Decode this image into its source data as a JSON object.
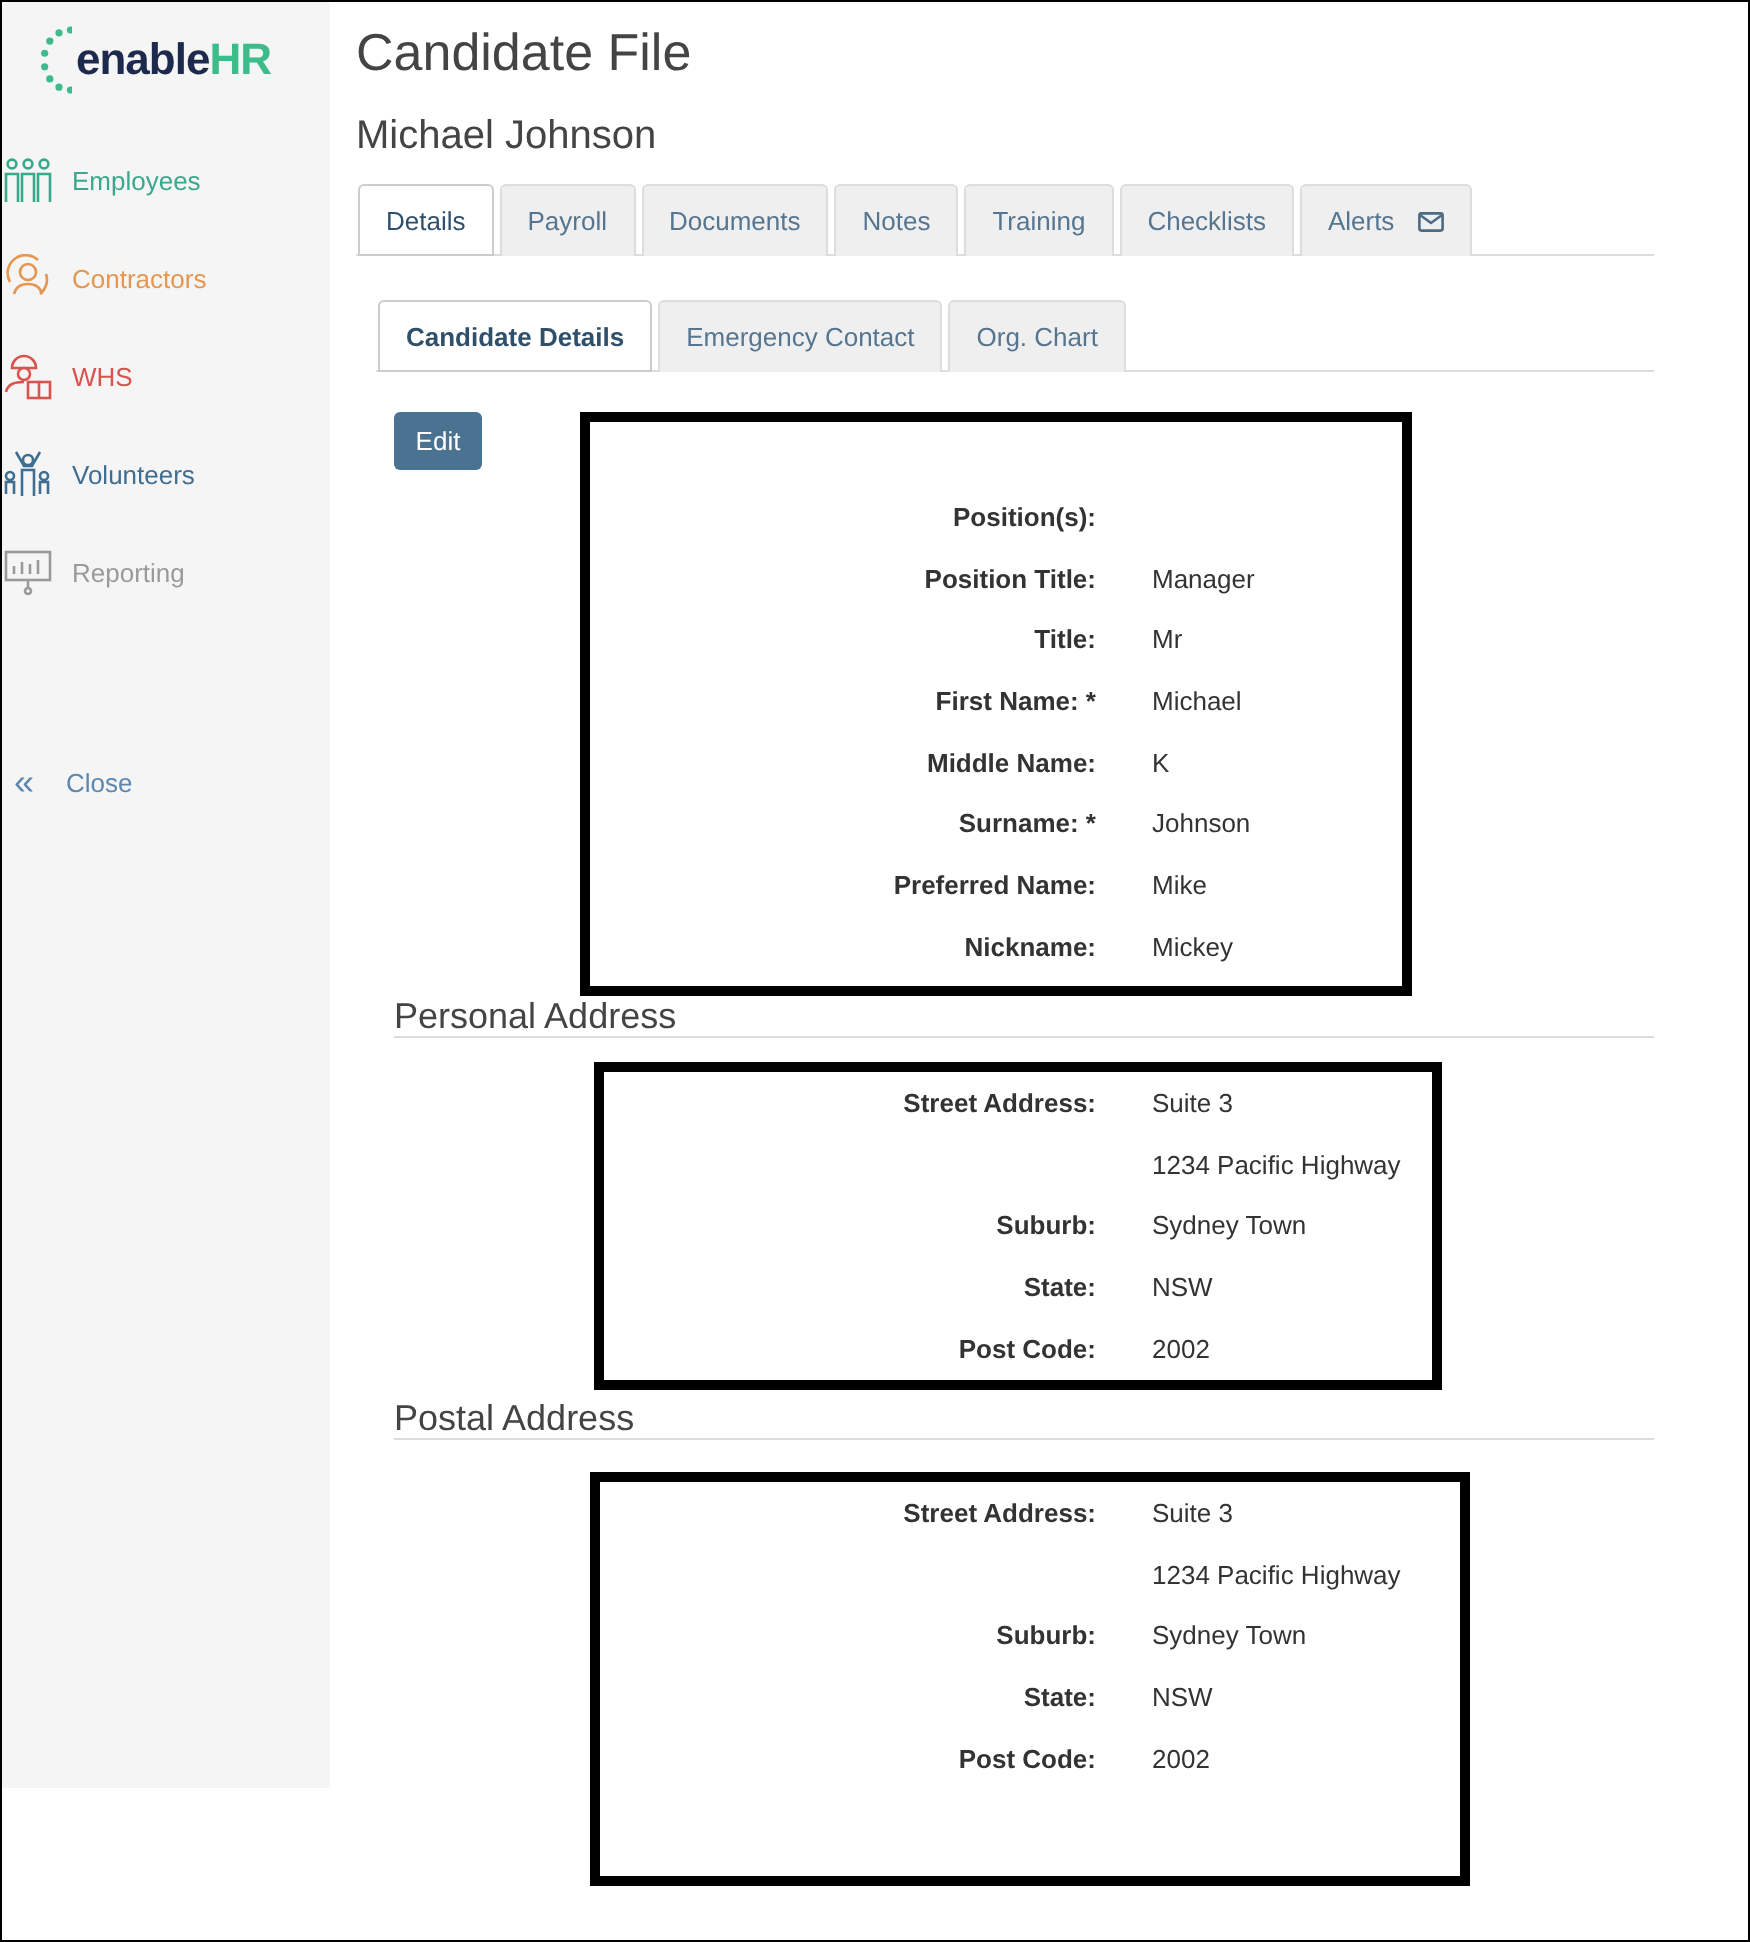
{
  "logo": {
    "primary": "enable",
    "accent": "HR"
  },
  "sidebar": {
    "items": [
      {
        "label": "Employees",
        "kind": "employees",
        "color": "#3aa88a"
      },
      {
        "label": "Contractors",
        "kind": "contractors",
        "color": "#e59650"
      },
      {
        "label": "WHS",
        "kind": "whs",
        "color": "#d9534f"
      },
      {
        "label": "Volunteers",
        "kind": "volunteers",
        "color": "#3f6e93"
      },
      {
        "label": "Reporting",
        "kind": "reporting",
        "color": "#9a9a9a"
      }
    ],
    "close": {
      "icon": "«",
      "label": "Close"
    }
  },
  "page": {
    "title": "Candidate File",
    "subtitle": "Michael Johnson"
  },
  "tabs": [
    {
      "label": "Details",
      "selected": true,
      "kind": "plain"
    },
    {
      "label": "Payroll",
      "selected": false,
      "kind": "plain"
    },
    {
      "label": "Documents",
      "selected": false,
      "kind": "plain"
    },
    {
      "label": "Notes",
      "selected": false,
      "kind": "plain"
    },
    {
      "label": "Training",
      "selected": false,
      "kind": "plain"
    },
    {
      "label": "Checklists",
      "selected": false,
      "kind": "plain"
    },
    {
      "label": "Alerts",
      "selected": false,
      "kind": "mail"
    }
  ],
  "subtabs": [
    {
      "label": "Candidate Details",
      "selected": true
    },
    {
      "label": "Emergency Contact",
      "selected": false
    },
    {
      "label": "Org. Chart",
      "selected": false
    }
  ],
  "edit_button": "Edit",
  "details": [
    {
      "label": "Position(s):"
    },
    {
      "label": "Position Title:",
      "value": "Manager"
    },
    {
      "label": "Title:",
      "value": "Mr"
    },
    {
      "label": "First Name: *",
      "value": "Michael"
    },
    {
      "label": "Middle Name:",
      "value": "K"
    },
    {
      "label": "Surname: *",
      "value": "Johnson"
    },
    {
      "label": "Preferred Name:",
      "value": "Mike"
    },
    {
      "label": "Nickname:",
      "value": "Mickey"
    }
  ],
  "sections": [
    {
      "title": "Personal Address",
      "fields": [
        {
          "label": "Street Address:",
          "value": "Suite 3"
        },
        {
          "value": "1234 Pacific Highway"
        },
        {
          "label": "Suburb:",
          "value": "Sydney Town"
        },
        {
          "label": "State:",
          "value": "NSW"
        },
        {
          "label": "Post Code:",
          "value": "2002"
        }
      ]
    },
    {
      "title": "Postal Address",
      "fields": [
        {
          "label": "Street Address:",
          "value": "Suite 3"
        },
        {
          "value": "1234 Pacific Highway"
        },
        {
          "label": "Suburb:",
          "value": "Sydney Town"
        },
        {
          "label": "State:",
          "value": "NSW"
        },
        {
          "label": "Post Code:",
          "value": "2002"
        }
      ]
    }
  ]
}
